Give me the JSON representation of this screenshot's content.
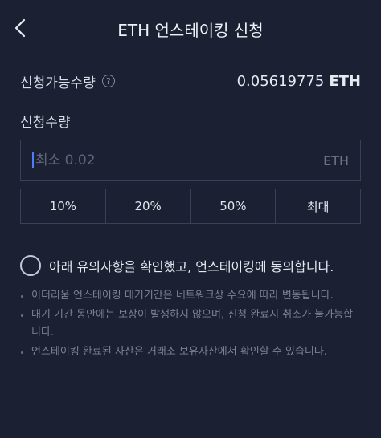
{
  "header": {
    "title": "ETH 언스테이킹 신청"
  },
  "available": {
    "label": "신청가능수량",
    "value": "0.05619775",
    "unit": "ETH"
  },
  "amount": {
    "label": "신청수량",
    "placeholder": "최소 0.02",
    "unit": "ETH"
  },
  "percent_buttons": [
    "10%",
    "20%",
    "50%",
    "최대"
  ],
  "agreement": {
    "text": "아래 유의사항을 확인했고, 언스테이킹에 동의합니다.",
    "checked": false
  },
  "notes": [
    "이더리움 언스테이킹 대기기간은 네트워크상 수요에 따라 변동됩니다.",
    "대기 기간 동안에는 보상이 발생하지 않으며, 신청 완료시 취소가 불가능합니다.",
    "언스테이킹 완료된 자산은 거래소 보유자산에서 확인할 수 있습니다."
  ],
  "colors": {
    "background": "#1b2133",
    "border": "#3a4157",
    "cursor": "#4f7cf7"
  }
}
